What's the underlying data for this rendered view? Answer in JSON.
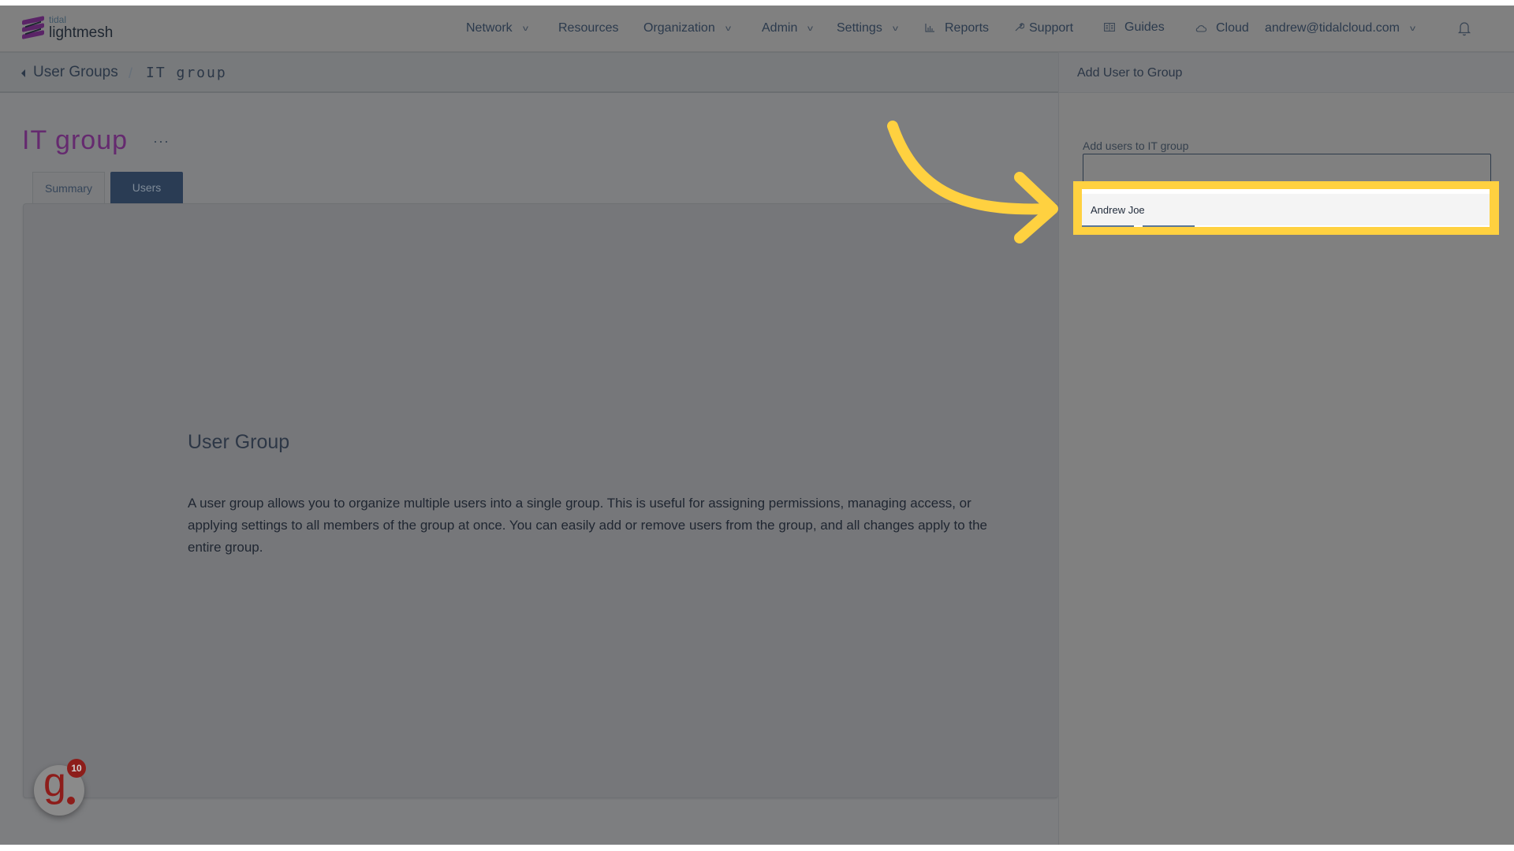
{
  "app": {
    "logo_small": "tidal",
    "logo_big": "lightmesh"
  },
  "nav": {
    "items": [
      {
        "label": "Network",
        "dropdown": true,
        "icon": null
      },
      {
        "label": "Resources",
        "dropdown": false,
        "icon": null
      },
      {
        "label": "Organization",
        "dropdown": true,
        "icon": null
      },
      {
        "label": "Admin",
        "dropdown": true,
        "icon": null
      },
      {
        "label": "Settings",
        "dropdown": true,
        "icon": null
      },
      {
        "label": "Reports",
        "dropdown": false,
        "icon": "bar-chart-icon"
      },
      {
        "label": "Support",
        "dropdown": false,
        "icon": "wrench-icon"
      },
      {
        "label": "Guides",
        "dropdown": false,
        "icon": "book-icon"
      },
      {
        "label": "Cloud",
        "dropdown": false,
        "icon": "cloud-icon"
      }
    ],
    "user": "andrew@tidalcloud.com",
    "notifications_icon": "bell-icon"
  },
  "breadcrumb": {
    "parent": "User Groups",
    "separator": "/",
    "current": "IT group"
  },
  "page": {
    "title": "IT group",
    "more": "···",
    "tabs": [
      {
        "label": "Summary",
        "active": false
      },
      {
        "label": "Users",
        "active": true
      }
    ],
    "card": {
      "heading": "User Group",
      "text": "A user group allows you to organize multiple users into a single group. This is useful for assigning permissions, managing access, or applying settings to all members of the group at once. You can easily add or remove users from the group, and all changes apply to the entire group."
    }
  },
  "panel": {
    "title": "Add User to Group",
    "field_label": "Add users to IT group",
    "field_value": "",
    "dropdown_options": [
      "Andrew Joe"
    ]
  },
  "badge": {
    "letter": "g",
    "count": "10"
  },
  "colors": {
    "highlight": "#ffd140",
    "title_accent": "#652a6f",
    "active_tab": "#2a3c54",
    "badge": "#8d1d1a"
  }
}
